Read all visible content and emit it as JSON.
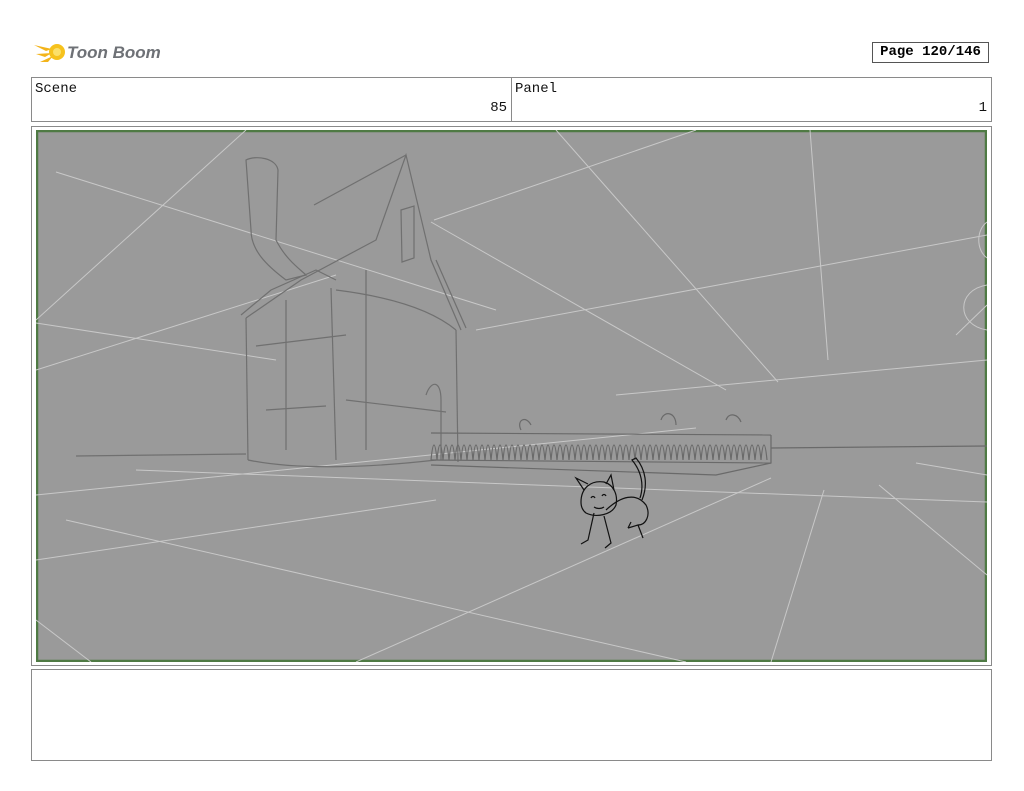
{
  "header": {
    "logo_text": "Toon Boom",
    "page_label": "Page 120/146"
  },
  "info": {
    "scene_label": "Scene",
    "scene_value": "85",
    "panel_label": "Panel",
    "panel_value": "1"
  },
  "panel": {
    "background_color": "#9a9a9a",
    "border_color": "#4f7a44"
  },
  "notes": {
    "text": ""
  }
}
